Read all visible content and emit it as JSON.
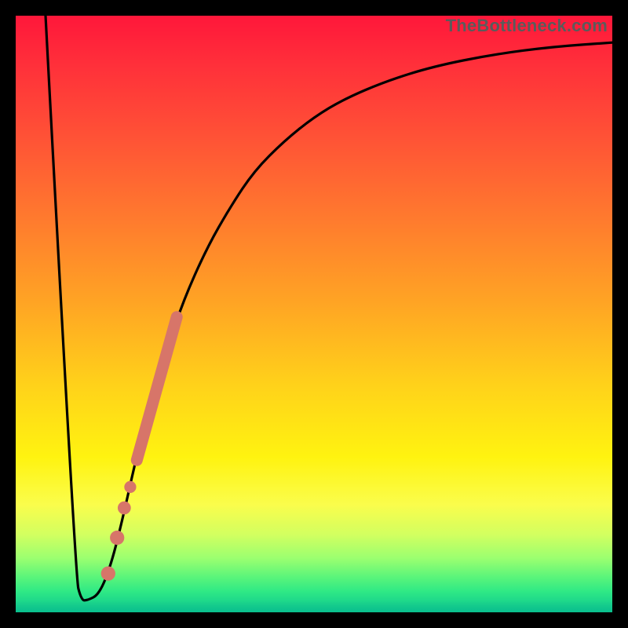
{
  "watermark": "TheBottleneck.com",
  "colors": {
    "curve": "#000000",
    "marker_fill": "#d77569",
    "marker_stroke": "#d77569"
  },
  "chart_data": {
    "type": "line",
    "title": "",
    "xlabel": "",
    "ylabel": "",
    "xlim": [
      0,
      100
    ],
    "ylim": [
      0,
      100
    ],
    "grid": false,
    "legend": false,
    "series": [
      {
        "name": "bottleneck-curve",
        "x": [
          5,
          10,
          11,
          12,
          14,
          16,
          18,
          20,
          22,
          25,
          28,
          32,
          36,
          40,
          45,
          50,
          55,
          62,
          70,
          80,
          90,
          100
        ],
        "values": [
          100,
          6,
          2,
          2,
          3,
          8,
          16,
          25,
          33,
          43,
          52,
          61,
          68,
          74,
          79,
          83,
          86,
          89,
          91.5,
          93.5,
          94.8,
          95.5
        ]
      }
    ],
    "markers": [
      {
        "name": "dot",
        "x": 15.5,
        "y": 6.5,
        "r": 1.2
      },
      {
        "name": "dot",
        "x": 17.0,
        "y": 12.5,
        "r": 1.2
      },
      {
        "name": "dot",
        "x": 18.2,
        "y": 17.5,
        "r": 1.1
      },
      {
        "name": "dot",
        "x": 19.2,
        "y": 21.0,
        "r": 1.0
      },
      {
        "name": "bar-start",
        "x": 20.3,
        "y": 25.5
      },
      {
        "name": "bar-end",
        "x": 27.0,
        "y": 49.5
      }
    ]
  }
}
